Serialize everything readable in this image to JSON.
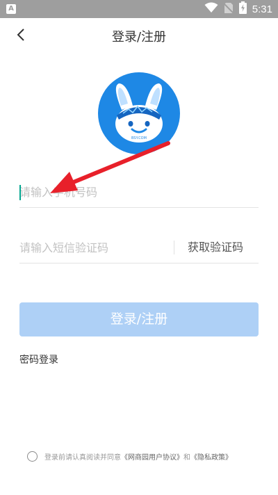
{
  "status_bar": {
    "app_icon_letter": "A",
    "time": "5:31",
    "icons": [
      "wifi-icon",
      "no-sim-icon",
      "battery-charging-icon"
    ]
  },
  "header": {
    "title": "登录/注册",
    "back_icon": "chevron-left-icon"
  },
  "avatar": {
    "icon": "bunny-robot-logo",
    "brand_color": "#1e88e5",
    "logo_text": "BSY.COM"
  },
  "form": {
    "phone_placeholder": "请输入手机号码",
    "phone_value": "",
    "code_placeholder": "请输入短信验证码",
    "code_value": "",
    "get_code_label": "获取验证码",
    "login_button_label": "登录/注册",
    "password_login_label": "密码登录"
  },
  "agreement": {
    "prefix": "登录前请认真阅读并同意",
    "user_agreement": "《网商园用户协议》",
    "joiner": "和",
    "privacy_policy": "《隐私政策》",
    "checked": false
  },
  "colors": {
    "accent_disabled": "#aed0f6",
    "caret": "#00a58e",
    "annotation_arrow": "#e8202a"
  }
}
